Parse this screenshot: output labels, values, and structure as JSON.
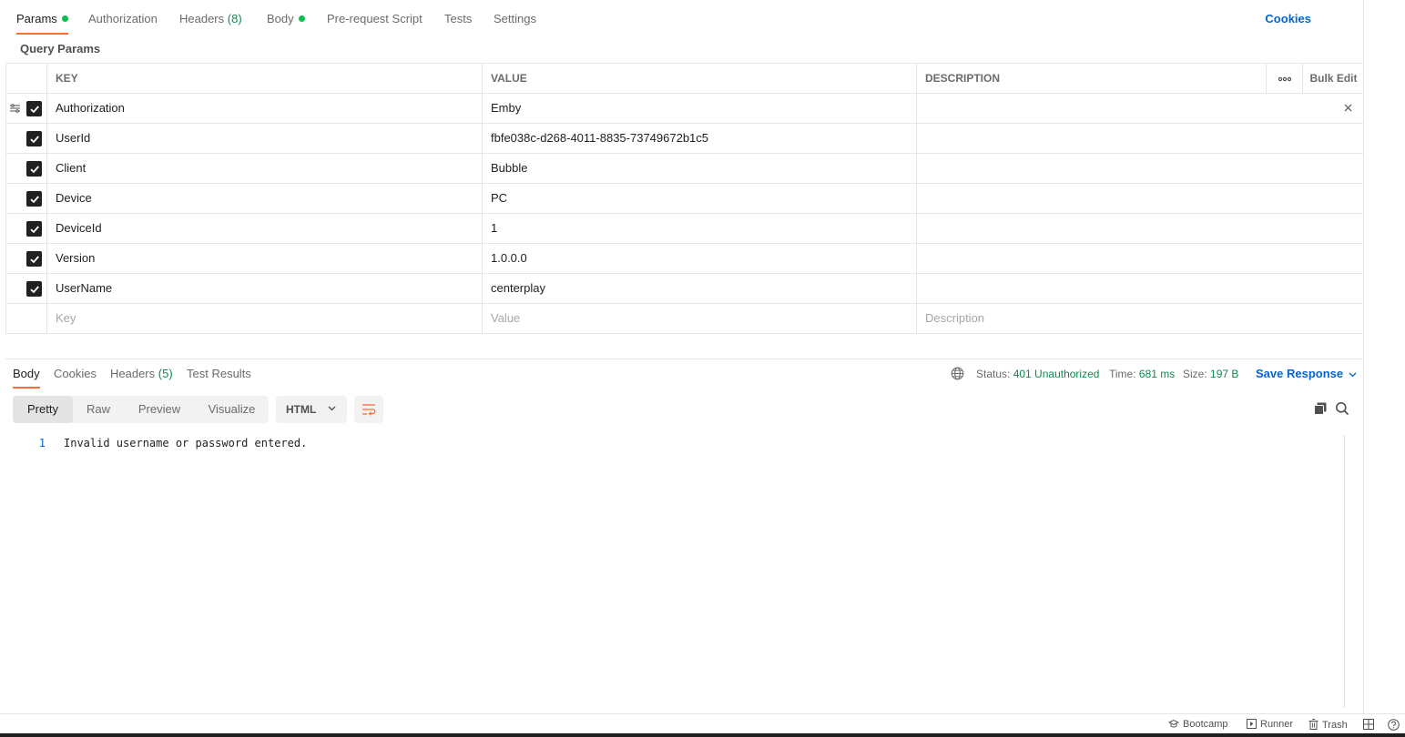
{
  "request_tabs": {
    "params": "Params",
    "authorization": "Authorization",
    "headers": "Headers",
    "headers_count": "(8)",
    "body": "Body",
    "pre_request": "Pre-request Script",
    "tests": "Tests",
    "settings": "Settings",
    "cookies": "Cookies"
  },
  "section_label": "Query Params",
  "params_table": {
    "headers": {
      "key": "KEY",
      "value": "VALUE",
      "description": "DESCRIPTION",
      "bulk_edit": "Bulk Edit"
    },
    "rows": [
      {
        "key": "Authorization",
        "value": "Emby",
        "description": ""
      },
      {
        "key": "UserId",
        "value": "fbfe038c-d268-4011-8835-73749672b1c5",
        "description": ""
      },
      {
        "key": "Client",
        "value": "Bubble",
        "description": ""
      },
      {
        "key": "Device",
        "value": "PC",
        "description": ""
      },
      {
        "key": "DeviceId",
        "value": "1",
        "description": ""
      },
      {
        "key": "Version",
        "value": "1.0.0.0",
        "description": ""
      },
      {
        "key": "UserName",
        "value": "centerplay",
        "description": ""
      }
    ],
    "placeholders": {
      "key": "Key",
      "value": "Value",
      "description": "Description"
    }
  },
  "response_tabs": {
    "body": "Body",
    "cookies": "Cookies",
    "headers": "Headers",
    "headers_count": "(5)",
    "test_results": "Test Results"
  },
  "response_meta": {
    "status_label": "Status:",
    "status_value": "401 Unauthorized",
    "time_label": "Time:",
    "time_value": "681 ms",
    "size_label": "Size:",
    "size_value": "197 B",
    "save_response": "Save Response"
  },
  "view_modes": {
    "pretty": "Pretty",
    "raw": "Raw",
    "preview": "Preview",
    "visualize": "Visualize",
    "format": "HTML"
  },
  "response_body": {
    "line_number": "1",
    "text": "Invalid username or password entered."
  },
  "footer": {
    "bootcamp": "Bootcamp",
    "runner": "Runner",
    "trash": "Trash"
  },
  "colors": {
    "accent": "#ff6c37",
    "link": "#0265d2",
    "success": "#0f8a4e",
    "dot": "#0cbb52"
  }
}
